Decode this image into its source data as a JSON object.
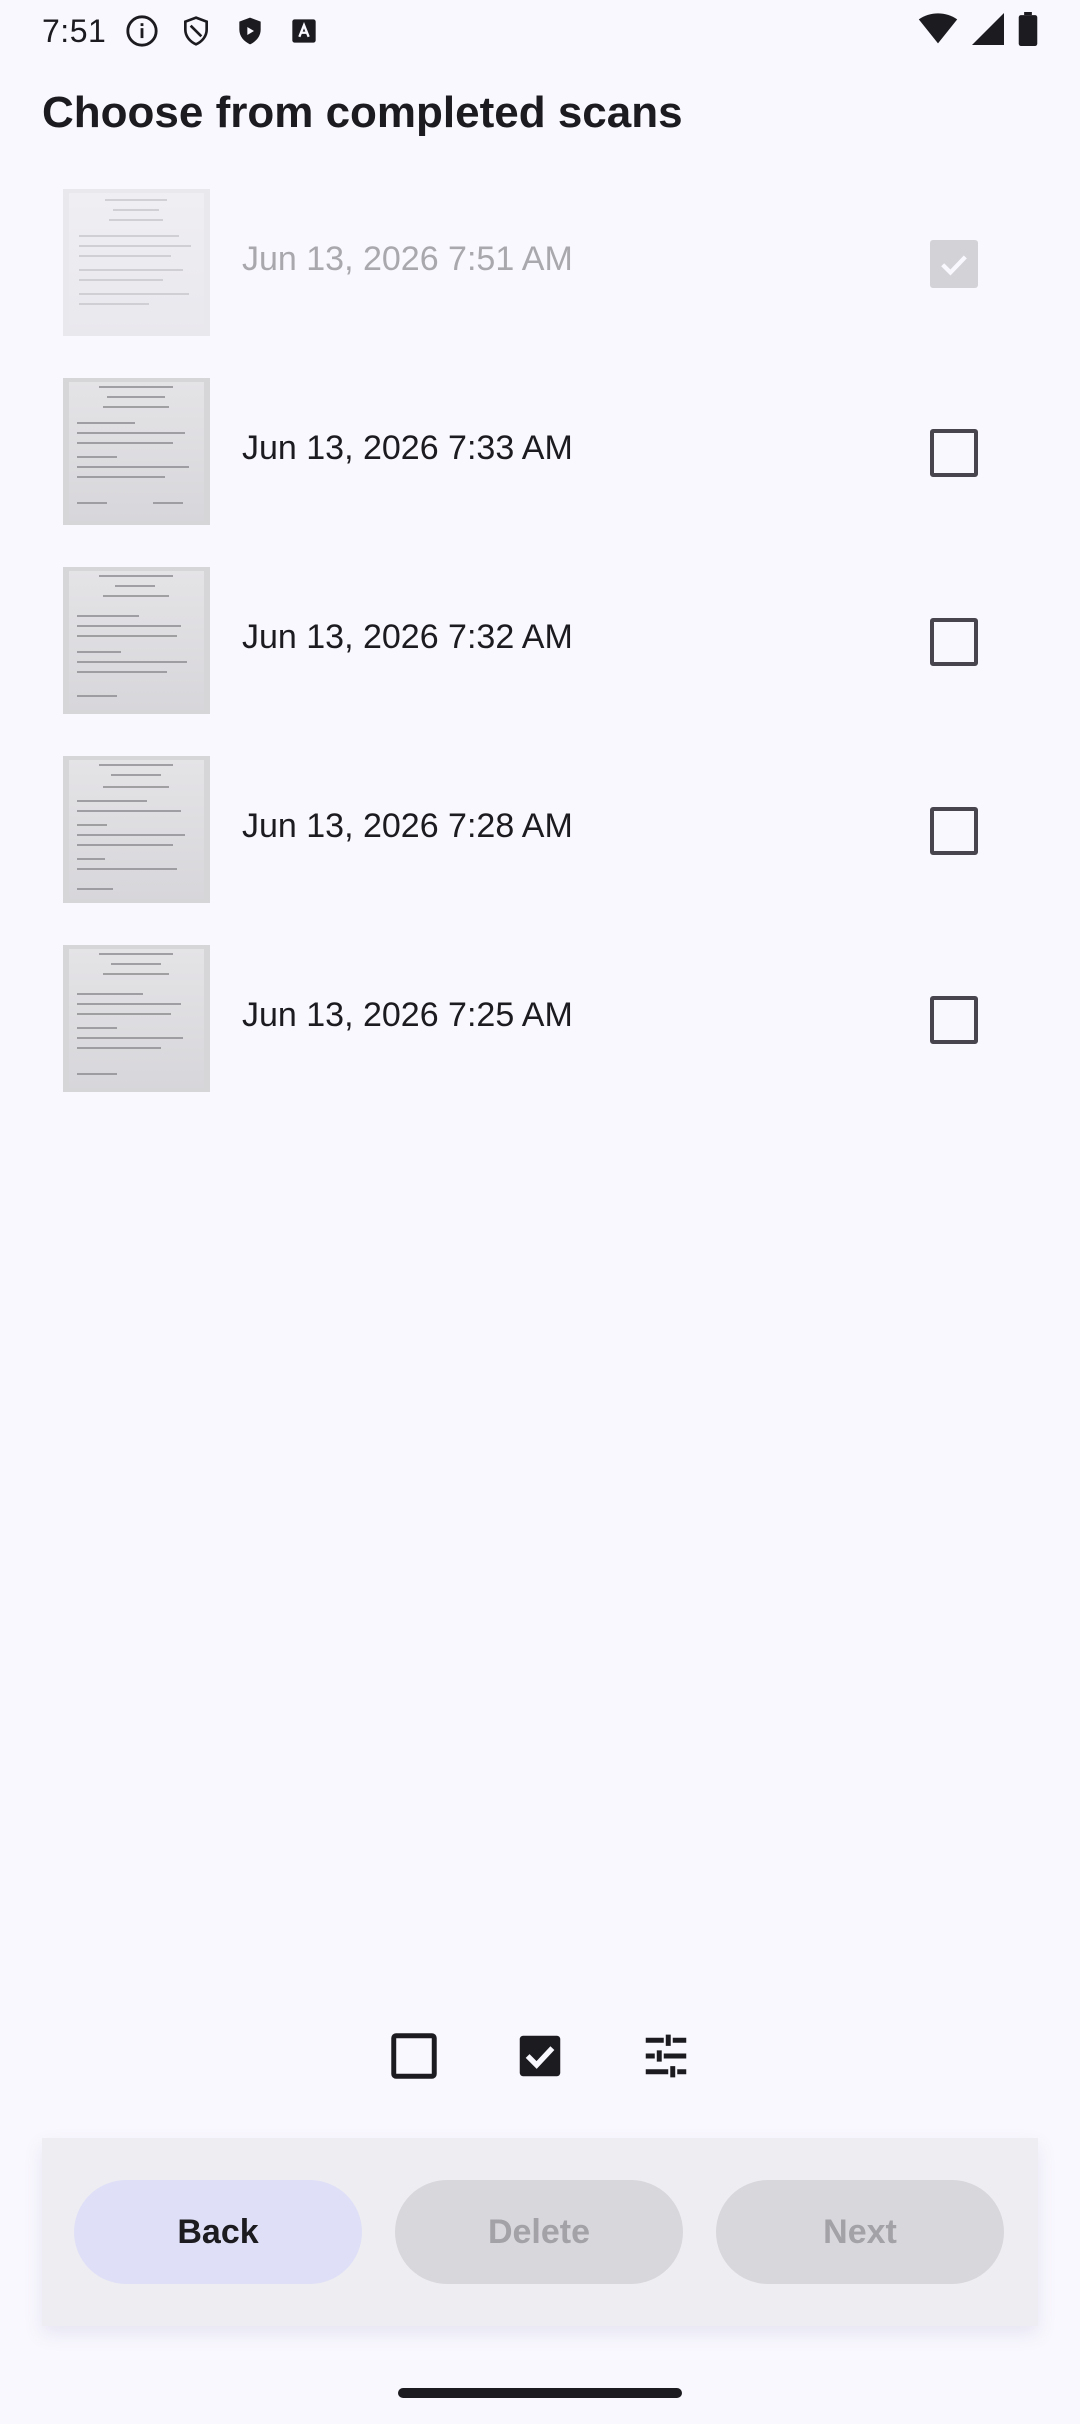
{
  "status_bar": {
    "time": "7:51",
    "icons": [
      "info-icon",
      "shield-outline-icon",
      "shield-filled-icon",
      "text-box-icon",
      "wifi-icon",
      "signal-icon",
      "battery-icon"
    ]
  },
  "title": "Choose from completed scans",
  "scans": [
    {
      "date": "Jun 13, 2026 7:51 AM",
      "checked": true,
      "enabled": false
    },
    {
      "date": "Jun 13, 2026 7:33 AM",
      "checked": false,
      "enabled": true
    },
    {
      "date": "Jun 13, 2026 7:32 AM",
      "checked": false,
      "enabled": true
    },
    {
      "date": "Jun 13, 2026 7:28 AM",
      "checked": false,
      "enabled": true
    },
    {
      "date": "Jun 13, 2026 7:25 AM",
      "checked": false,
      "enabled": true
    }
  ],
  "tools": [
    "deselect-all-icon",
    "select-all-icon",
    "filter-sliders-icon"
  ],
  "actions": {
    "back_label": "Back",
    "delete_label": "Delete",
    "next_label": "Next"
  },
  "colors": {
    "background": "#f9f8fe",
    "back_button": "#dfe0f7",
    "disabled_button": "#d8d7dc",
    "disabled_text": "#a3a2a7"
  }
}
